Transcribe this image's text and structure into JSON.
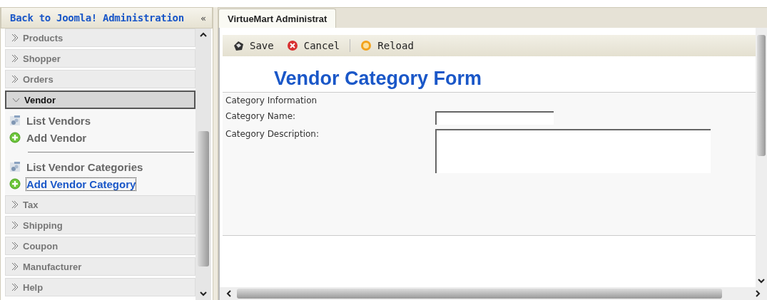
{
  "sidebar": {
    "back_link": "Back to Joomla! Administration",
    "collapse_button": "«",
    "sections": [
      {
        "label": "Products",
        "expanded": false
      },
      {
        "label": "Shopper",
        "expanded": false
      },
      {
        "label": "Orders",
        "expanded": false
      },
      {
        "label": "Vendor",
        "expanded": true,
        "groups": [
          {
            "items": [
              {
                "label": "List Vendors",
                "kind": "list",
                "selected": false
              },
              {
                "label": "Add Vendor",
                "kind": "add",
                "selected": false
              }
            ]
          },
          {
            "items": [
              {
                "label": "List Vendor Categories",
                "kind": "list",
                "selected": false
              },
              {
                "label": "Add Vendor Category",
                "kind": "add",
                "selected": true
              }
            ]
          }
        ]
      },
      {
        "label": "Tax",
        "expanded": false
      },
      {
        "label": "Shipping",
        "expanded": false
      },
      {
        "label": "Coupon",
        "expanded": false
      },
      {
        "label": "Manufacturer",
        "expanded": false
      },
      {
        "label": "Help",
        "expanded": false
      }
    ]
  },
  "tabs": [
    {
      "label": "VirtueMart Administrat",
      "selected": true
    }
  ],
  "toolbar": [
    {
      "label": "Save",
      "kind": "save",
      "separator_before": false
    },
    {
      "label": "Cancel",
      "kind": "cancel",
      "separator_before": false
    },
    {
      "label": "Reload",
      "kind": "reload",
      "separator_before": true
    }
  ],
  "form": {
    "title": "Vendor Category Form",
    "section": "Category Information",
    "fields": [
      {
        "label": "Category Name:",
        "kind": "text"
      },
      {
        "label": "Category Description:",
        "kind": "textarea"
      }
    ]
  }
}
